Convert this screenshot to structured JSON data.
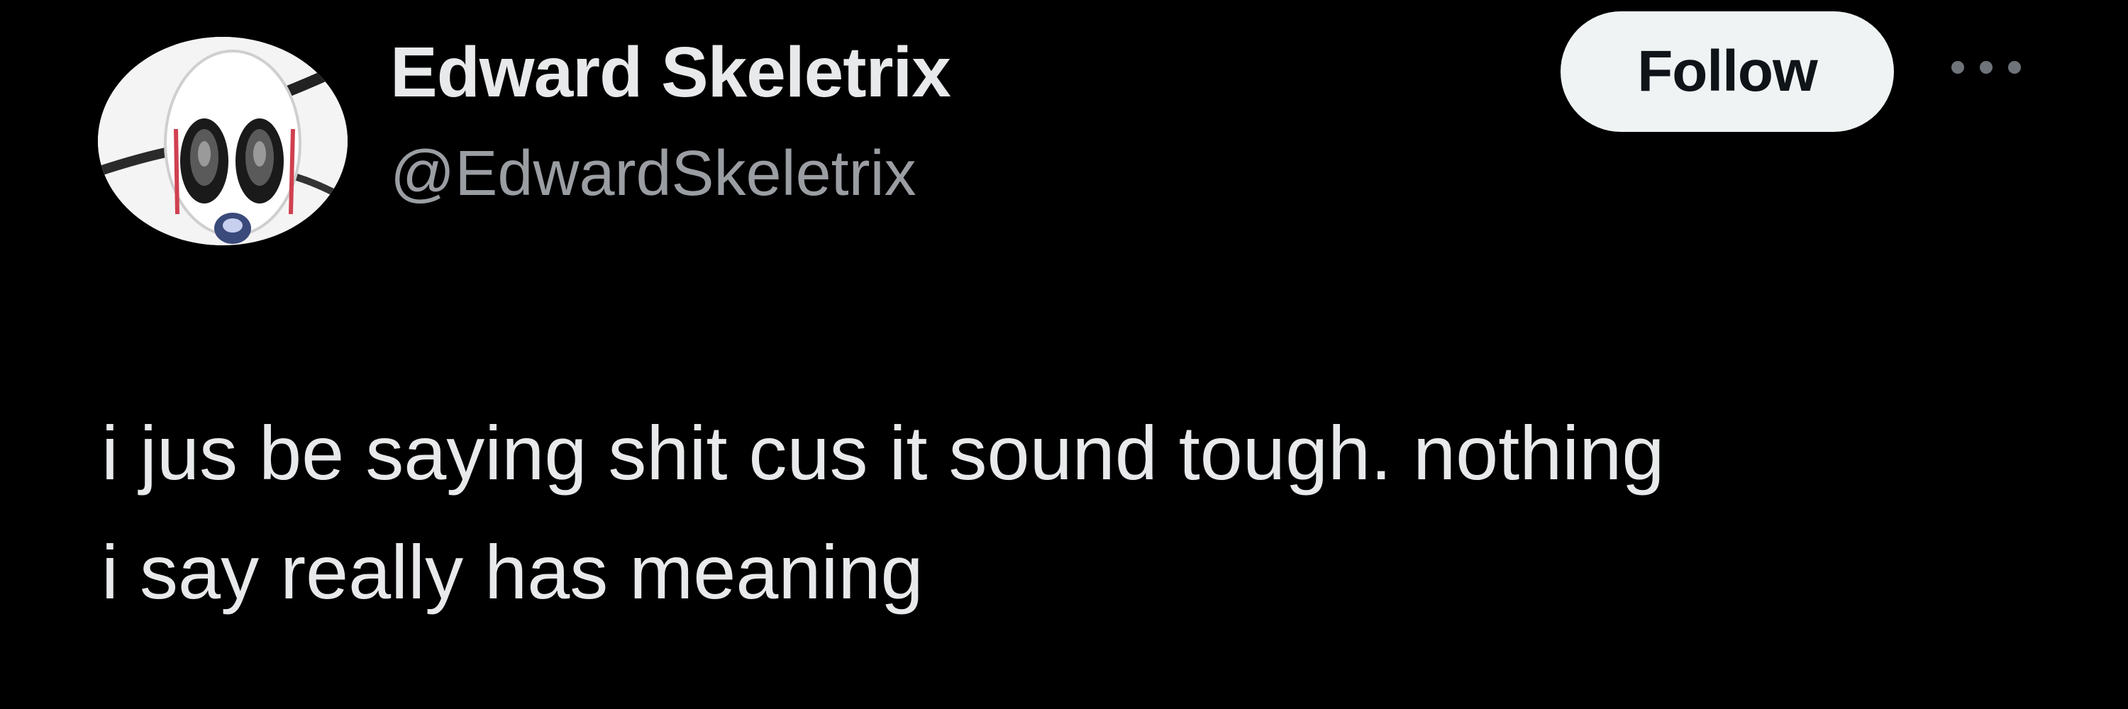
{
  "author": {
    "display_name": "Edward Skeletrix",
    "handle": "@EdwardSkeletrix",
    "avatar_icon": "skull-avatar"
  },
  "actions": {
    "follow_label": "Follow",
    "more_icon": "more-dots-icon"
  },
  "tweet": {
    "text": "i jus be saying shit cus it sound tough. nothing\ni say really has meaning"
  },
  "colors": {
    "background": "#000000",
    "primary_text": "#e7e9ea",
    "secondary_text": "#9a9ea3",
    "follow_button_bg": "#eff3f4",
    "follow_button_text": "#0f1419"
  }
}
